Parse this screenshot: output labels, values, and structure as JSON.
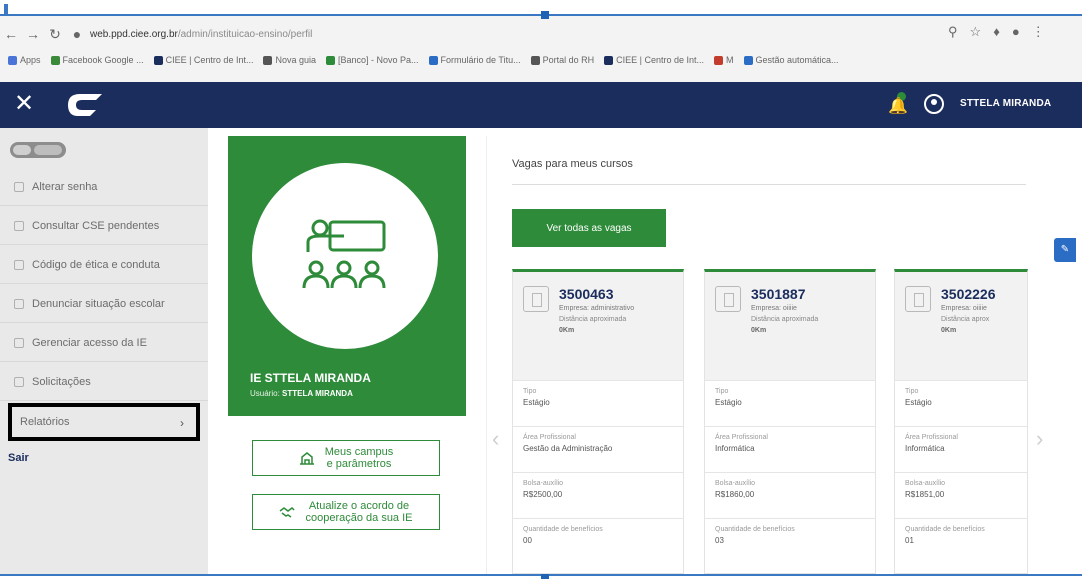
{
  "browser": {
    "url_host": "web.ppd.ciee.org.br",
    "url_path": "/admin/instituicao-ensino/perfil",
    "bookmarks": [
      {
        "label": "Apps",
        "color": "#4a74d8"
      },
      {
        "label": "Facebook Google ...",
        "color": "#3a8a3a"
      },
      {
        "label": "CIEE | Centro de Int...",
        "color": "#1b2d5d"
      },
      {
        "label": "Nova guia",
        "color": "#555555"
      },
      {
        "label": "[Banco] - Novo Pa...",
        "color": "#2e8b3a"
      },
      {
        "label": "Formulário de Titu...",
        "color": "#2b6cc4"
      },
      {
        "label": "Portal do RH",
        "color": "#555555"
      },
      {
        "label": "CIEE | Centro de Int...",
        "color": "#1b2d5d"
      },
      {
        "label": "M",
        "color": "#c23b2b"
      },
      {
        "label": "Gestão automática...",
        "color": "#2b6cc4"
      }
    ]
  },
  "header": {
    "user_name": "STTELA MIRANDA",
    "logo": "ciee-logo",
    "bell_icon": "bell-icon"
  },
  "sidebar": {
    "items": [
      {
        "label": "Alterar senha"
      },
      {
        "label": "Consultar CSE pendentes"
      },
      {
        "label": "Código de ética e conduta"
      },
      {
        "label": "Denunciar situação escolar"
      },
      {
        "label": "Gerenciar acesso da IE"
      },
      {
        "label": "Solicitações"
      }
    ],
    "selected_item": "Relatórios",
    "exit_label": "Sair"
  },
  "profile": {
    "title": "IE STTELA MIRANDA",
    "user_label": "Usuário:",
    "user_value": "STTELA MIRANDA",
    "buttons": [
      {
        "label_line1": "Meus campus",
        "label_line2": "e parâmetros"
      },
      {
        "label_line1": "Atualize o acordo de",
        "label_line2": "cooperação da sua IE"
      }
    ]
  },
  "jobs": {
    "title": "Vagas para meus cursos",
    "see_all_label": "Ver todas as vagas",
    "field_labels": {
      "type": "Tipo",
      "area": "Área Profissional",
      "grant": "Bolsa-auxílio",
      "benefits": "Quantidade de benefícios"
    },
    "cards": [
      {
        "number": "3500463",
        "company": "Empresa: administrativo",
        "distance_label": "Distância aproximada",
        "distance": "0Km",
        "type": "Estágio",
        "area": "Gestão da Administração",
        "grant": "R$2500,00",
        "benefits": "00"
      },
      {
        "number": "3501887",
        "company": "Empresa: oiiiie",
        "distance_label": "Distância aproximada",
        "distance": "0Km",
        "type": "Estágio",
        "area": "Informática",
        "grant": "R$1860,00",
        "benefits": "03"
      },
      {
        "number": "3502226",
        "company": "Empresa: oiiiie",
        "distance_label": "Distância aprox",
        "distance": "0Km",
        "type": "Estágio",
        "area": "Informática",
        "grant": "R$1851,00",
        "benefits": "01"
      }
    ]
  },
  "colors": {
    "header_bg": "#1b2d5d",
    "accent_green": "#2e8b3a",
    "sidebar_bg": "#e9e9e9"
  }
}
